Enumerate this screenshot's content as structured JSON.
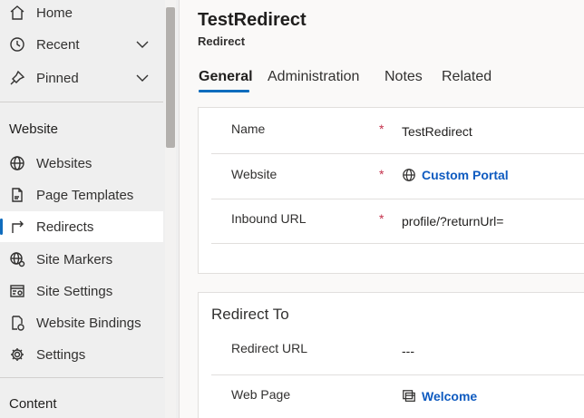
{
  "sidebar": {
    "top_items": [
      {
        "label": "Home",
        "icon": "home-icon"
      },
      {
        "label": "Recent",
        "icon": "clock-icon",
        "has_chevron": true
      },
      {
        "label": "Pinned",
        "icon": "pin-icon",
        "has_chevron": true
      }
    ],
    "website_section": {
      "header": "Website",
      "items": [
        {
          "label": "Websites",
          "icon": "globe-icon"
        },
        {
          "label": "Page Templates",
          "icon": "page-icon"
        },
        {
          "label": "Redirects",
          "icon": "redirect-icon",
          "selected": true
        },
        {
          "label": "Site Markers",
          "icon": "globe-marker-icon"
        },
        {
          "label": "Site Settings",
          "icon": "settings-panel-icon"
        },
        {
          "label": "Website Bindings",
          "icon": "binding-icon"
        },
        {
          "label": "Settings",
          "icon": "gear-icon"
        }
      ]
    },
    "content_section": {
      "header": "Content"
    }
  },
  "record": {
    "title": "TestRedirect",
    "subtitle": "Redirect"
  },
  "tabs": [
    {
      "label": "General",
      "active": true
    },
    {
      "label": "Administration"
    },
    {
      "label": "Notes"
    },
    {
      "label": "Related"
    }
  ],
  "general_card": {
    "fields": [
      {
        "label": "Name",
        "required": "*",
        "value": "TestRedirect"
      },
      {
        "label": "Website",
        "required": "*",
        "value": "Custom Portal",
        "is_link": true,
        "icon": "globe-icon"
      },
      {
        "label": "Inbound URL",
        "required": "*",
        "value": "profile/?returnUrl="
      }
    ]
  },
  "redirect_card": {
    "title": "Redirect To",
    "fields": [
      {
        "label": "Redirect URL",
        "value": "---"
      },
      {
        "label": "Web Page",
        "value": "Welcome",
        "is_link": true,
        "icon": "webpage-icon"
      }
    ]
  },
  "colors": {
    "accent": "#0f6cbd",
    "link": "#0f5bc0",
    "required": "#c4314b",
    "sidebar_bg": "#efefef"
  }
}
